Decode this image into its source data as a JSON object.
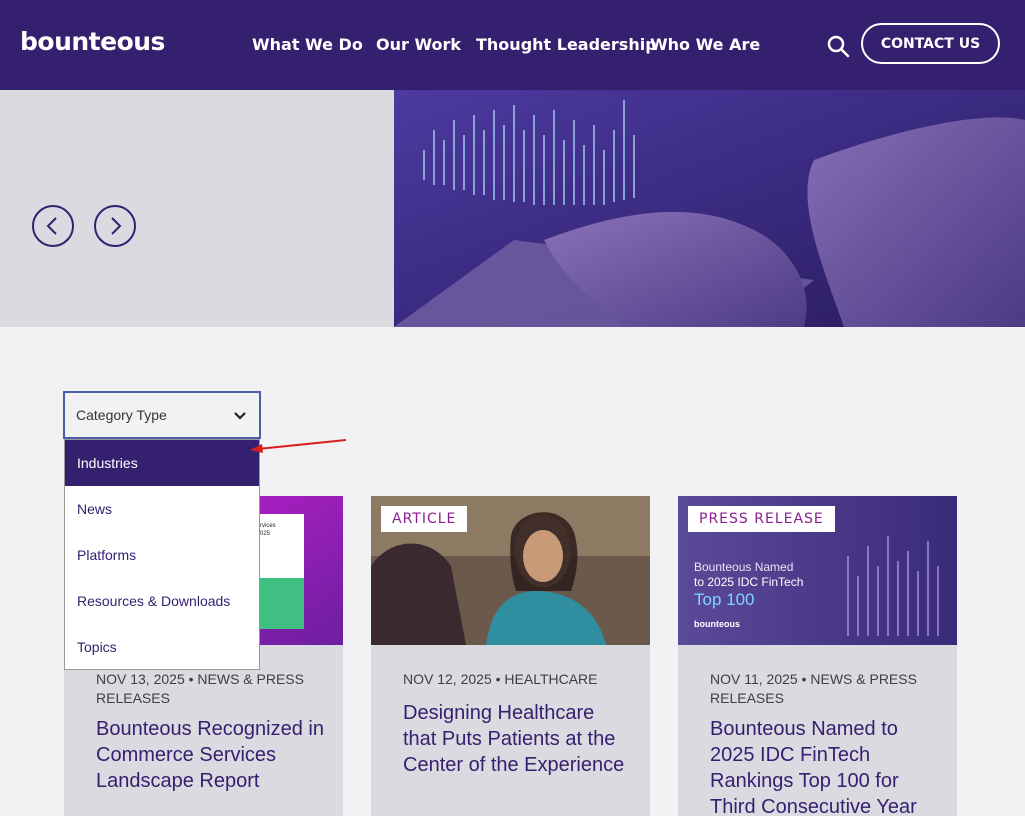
{
  "header": {
    "logo": "bounteous",
    "nav": [
      "What We Do",
      "Our Work",
      "Thought Leadership",
      "Who We Are"
    ],
    "contact_label": "CONTACT US"
  },
  "colors": {
    "brand": "#35206f",
    "tag_text": "#8b1f8f",
    "card_bg": "#dcdae1",
    "annotation": "#d81e1e"
  },
  "icons": [
    "search-icon",
    "chevron-left-icon",
    "chevron-right-icon",
    "chevron-down-icon"
  ],
  "filter": {
    "label": "Category Type",
    "options": [
      "Industries",
      "News",
      "Platforms",
      "Resources & Downloads",
      "Topics"
    ],
    "highlighted": "Industries"
  },
  "cards": [
    {
      "tag": "",
      "thumb_text": [
        "rvices",
        "025"
      ],
      "meta": "NOV 13, 2025 • NEWS & PRESS RELEASES",
      "title": "Bounteous Recognized in Commerce Services Landscape Report"
    },
    {
      "tag": "ARTICLE",
      "meta": "NOV 12, 2025 • HEALTHCARE",
      "title": "Designing Healthcare that Puts Patients at the Center of the Experience"
    },
    {
      "tag": "PRESS RELEASE",
      "thumb_text": [
        "Bounteous Named",
        "to 2025 IDC FinTech",
        "Top 100",
        "bounteous"
      ],
      "meta": "NOV 11, 2025 • NEWS & PRESS RELEASES",
      "title": "Bounteous Named to 2025 IDC FinTech Rankings Top 100 for Third Consecutive Year"
    }
  ]
}
